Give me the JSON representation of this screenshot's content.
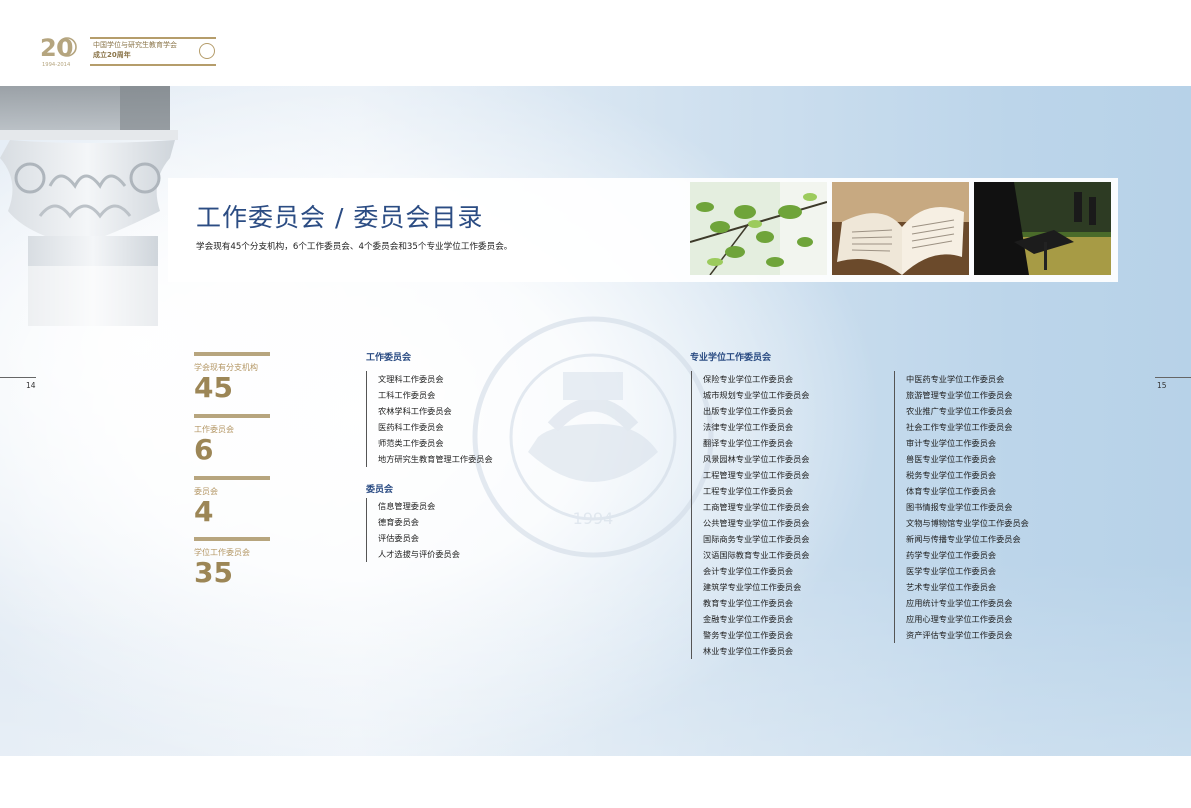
{
  "header": {
    "logo_numeral": "20",
    "logo_years": "1994-2014",
    "org_line1": "中国学位与研究生教育学会",
    "org_line2": "成立20周年"
  },
  "title": "工作委员会 / 委员会目录",
  "intro": "学会现有45个分支机构，6个工作委员会、4个委员会和35个专业学位工作委员会。",
  "page_numbers": {
    "left": "14",
    "right": "15"
  },
  "seal": {
    "year": "1994"
  },
  "stats": [
    {
      "label": "学会现有分支机构",
      "value": "45"
    },
    {
      "label": "工作委员会",
      "value": "6"
    },
    {
      "label": "委员会",
      "value": "4"
    },
    {
      "label": "学位工作委员会",
      "value": "35"
    }
  ],
  "work_committees": {
    "heading": "工作委员会",
    "items": [
      "文理科工作委员会",
      "工科工作委员会",
      "农林学科工作委员会",
      "医药科工作委员会",
      "师范类工作委员会",
      "地方研究生教育管理工作委员会"
    ]
  },
  "committees": {
    "heading": "委员会",
    "items": [
      "信息管理委员会",
      "德育委员会",
      "评估委员会",
      "人才选拔与评价委员会"
    ]
  },
  "professional_committees": {
    "heading": "专业学位工作委员会",
    "col1": [
      "保险专业学位工作委员会",
      "城市规划专业学位工作委员会",
      "出版专业学位工作委员会",
      "法律专业学位工作委员会",
      "翻译专业学位工作委员会",
      "风景园林专业学位工作委员会",
      "工程管理专业学位工作委员会",
      "工程专业学位工作委员会",
      "工商管理专业学位工作委员会",
      "公共管理专业学位工作委员会",
      "国际商务专业学位工作委员会",
      "汉语国际教育专业工作委员会",
      "会计专业学位工作委员会",
      "建筑学专业学位工作委员会",
      "教育专业学位工作委员会",
      "金融专业学位工作委员会",
      "警务专业学位工作委员会",
      "林业专业学位工作委员会"
    ],
    "col2": [
      "中医药专业学位工作委员会",
      "旅游管理专业学位工作委员会",
      "农业推广专业学位工作委员会",
      "社会工作专业学位工作委员会",
      "审计专业学位工作委员会",
      "兽医专业学位工作委员会",
      "税务专业学位工作委员会",
      "体育专业学位工作委员会",
      "图书情报专业学位工作委员会",
      "文物与博物馆专业学位工作委员会",
      "新闻与传播专业学位工作委员会",
      "药学专业学位工作委员会",
      "医学专业学位工作委员会",
      "艺术专业学位工作委员会",
      "应用统计专业学位工作委员会",
      "应用心理专业学位工作委员会",
      "资产评估专业学位工作委员会"
    ]
  }
}
